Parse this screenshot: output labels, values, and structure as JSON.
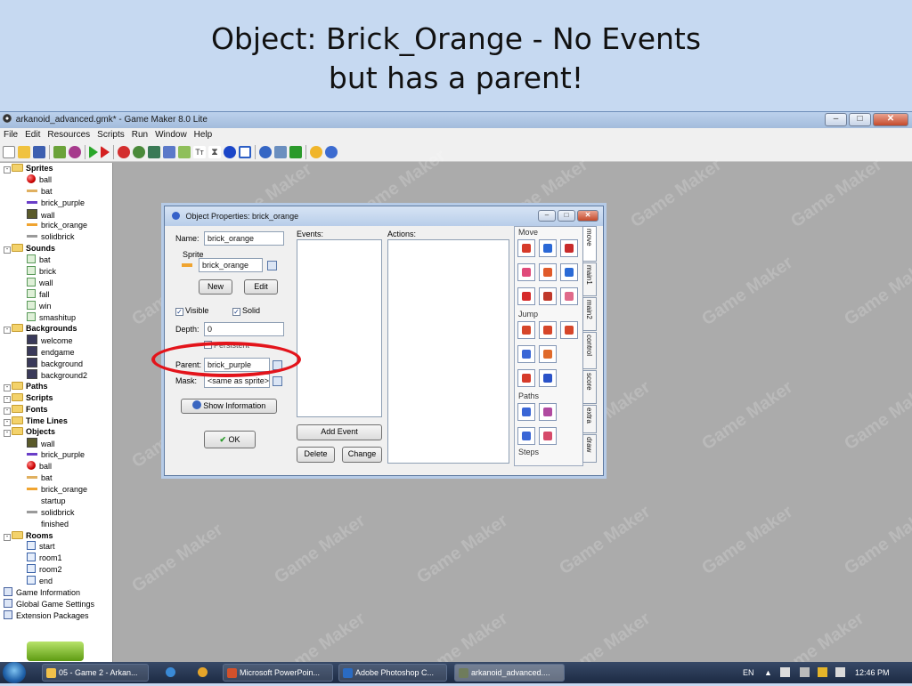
{
  "slide": {
    "title_line1": "Object: Brick_Orange - No Events",
    "title_line2": "but has a parent!"
  },
  "window": {
    "title": "arkanoid_advanced.gmk* - Game Maker 8.0 Lite",
    "menu": [
      "File",
      "Edit",
      "Resources",
      "Scripts",
      "Run",
      "Window",
      "Help"
    ]
  },
  "tree": {
    "rows": [
      {
        "label": "Sprites",
        "type": "group",
        "icon": "folder-icon"
      },
      {
        "label": "ball",
        "type": "item",
        "icon": "ball-icon"
      },
      {
        "label": "bat",
        "type": "item",
        "icon": "bat-sprite-icon"
      },
      {
        "label": "brick_purple",
        "type": "item",
        "icon": "purple-brick-icon"
      },
      {
        "label": "wall",
        "type": "item",
        "icon": "wall-icon"
      },
      {
        "label": "brick_orange",
        "type": "item",
        "icon": "orange-brick-icon"
      },
      {
        "label": "solidbrick",
        "type": "item",
        "icon": "grey-brick-icon"
      },
      {
        "label": "Sounds",
        "type": "group",
        "icon": "folder-icon"
      },
      {
        "label": "bat",
        "type": "item",
        "icon": "sound-icon"
      },
      {
        "label": "brick",
        "type": "item",
        "icon": "sound-icon"
      },
      {
        "label": "wall",
        "type": "item",
        "icon": "sound-icon"
      },
      {
        "label": "fall",
        "type": "item",
        "icon": "sound-icon"
      },
      {
        "label": "win",
        "type": "item",
        "icon": "sound-icon"
      },
      {
        "label": "smashitup",
        "type": "item",
        "icon": "sound-icon"
      },
      {
        "label": "Backgrounds",
        "type": "group",
        "icon": "folder-icon"
      },
      {
        "label": "welcome",
        "type": "item",
        "icon": "background-icon"
      },
      {
        "label": "endgame",
        "type": "item",
        "icon": "background-icon"
      },
      {
        "label": "background",
        "type": "item",
        "icon": "background-icon"
      },
      {
        "label": "background2",
        "type": "item",
        "icon": "background-icon"
      },
      {
        "label": "Paths",
        "type": "group",
        "icon": "folder-icon"
      },
      {
        "label": "Scripts",
        "type": "group",
        "icon": "folder-icon"
      },
      {
        "label": "Fonts",
        "type": "group",
        "icon": "folder-icon"
      },
      {
        "label": "Time Lines",
        "type": "group",
        "icon": "folder-icon"
      },
      {
        "label": "Objects",
        "type": "group",
        "icon": "folder-icon"
      },
      {
        "label": "wall",
        "type": "item",
        "icon": "wall-icon"
      },
      {
        "label": "brick_purple",
        "type": "item",
        "icon": "purple-brick-icon"
      },
      {
        "label": "ball",
        "type": "item",
        "icon": "ball-icon"
      },
      {
        "label": "bat",
        "type": "item",
        "icon": "bat-sprite-icon"
      },
      {
        "label": "brick_orange",
        "type": "item",
        "icon": "orange-brick-icon"
      },
      {
        "label": "startup",
        "type": "item",
        "icon": "blank-icon"
      },
      {
        "label": "solidbrick",
        "type": "item",
        "icon": "grey-brick-icon"
      },
      {
        "label": "finished",
        "type": "item",
        "icon": "blank-icon"
      },
      {
        "label": "Rooms",
        "type": "group",
        "icon": "folder-icon"
      },
      {
        "label": "start",
        "type": "item",
        "icon": "room-icon"
      },
      {
        "label": "room1",
        "type": "item",
        "icon": "room-icon"
      },
      {
        "label": "room2",
        "type": "item",
        "icon": "room-icon"
      },
      {
        "label": "end",
        "type": "item",
        "icon": "room-icon"
      },
      {
        "label": "Game Information",
        "type": "root",
        "icon": "info-icon"
      },
      {
        "label": "Global Game Settings",
        "type": "root",
        "icon": "settings-icon"
      },
      {
        "label": "Extension Packages",
        "type": "root",
        "icon": "extension-icon"
      }
    ]
  },
  "watermark": "Game Maker",
  "dialog": {
    "title": "Object Properties: brick_orange",
    "name_label": "Name:",
    "name_value": "brick_orange",
    "sprite_group": "Sprite",
    "sprite_value": "brick_orange",
    "new_button": "New",
    "edit_button": "Edit",
    "visible_label": "Visible",
    "solid_label": "Solid",
    "depth_label": "Depth:",
    "depth_value": "0",
    "persistent_label": "Persistent",
    "parent_label": "Parent:",
    "parent_value": "brick_purple",
    "mask_label": "Mask:",
    "mask_value": "<same as sprite>",
    "show_info_button": "Show Information",
    "ok_button": "OK",
    "events_label": "Events:",
    "actions_label": "Actions:",
    "add_event_button": "Add Event",
    "delete_button": "Delete",
    "change_button": "Change",
    "groups": {
      "move": "Move",
      "jump": "Jump",
      "paths": "Paths",
      "steps": "Steps"
    },
    "tabs": [
      "move",
      "main1",
      "main2",
      "control",
      "score",
      "extra",
      "draw"
    ]
  },
  "taskbar": {
    "buttons": [
      {
        "label": "05 - Game 2 - Arkan...",
        "color": "#f2c14a"
      },
      {
        "label": "Microsoft PowerPoin...",
        "color": "#d2512b"
      },
      {
        "label": "Adobe Photoshop C...",
        "color": "#2a6bc2"
      },
      {
        "label": "arkanoid_advanced....",
        "color": "#6f7c5c"
      }
    ],
    "lang": "EN",
    "clock": "12:46 PM"
  }
}
